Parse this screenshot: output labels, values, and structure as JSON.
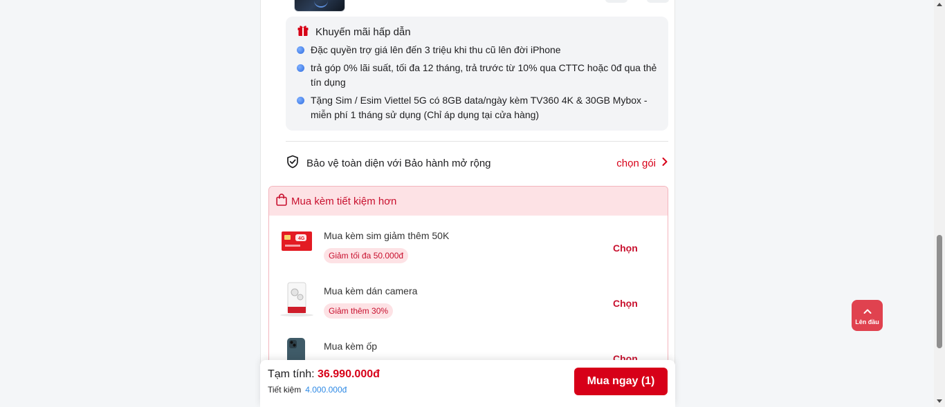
{
  "promotions": {
    "title": "Khuyến mãi hấp dẫn",
    "items": [
      "Đặc quyền trợ giá lên đến 3 triệu khi thu cũ lên đời iPhone",
      "trả góp 0% lãi suất, tối đa 12 tháng, trả trước từ 10% qua CTTC hoặc 0đ qua thẻ tín dụng",
      "Tặng Sim / Esim Viettel 5G có 8GB data/ngày kèm TV360 4K & 30GB Mybox - miễn phí 1 tháng sử dụng (Chỉ áp dụng tại cửa hàng)"
    ]
  },
  "warranty": {
    "label": "Bảo vệ toàn diện với Bảo hành mở rộng",
    "action": "chọn gói"
  },
  "bundle": {
    "title": "Mua kèm tiết kiệm hơn",
    "items": [
      {
        "title": "Mua kèm sim giảm thêm 50K",
        "badge": "Giảm tối đa 50.000đ",
        "action": "Chọn"
      },
      {
        "title": "Mua kèm dán camera",
        "badge": "Giảm thêm 30%",
        "action": "Chọn"
      },
      {
        "title": "Mua kèm ốp",
        "badge": "",
        "action": "Chọn"
      }
    ]
  },
  "footer": {
    "total_label": "Tạm tính:",
    "total_value": "36.990.000đ",
    "saving_label": "Tiết kiệm",
    "saving_value": "4.000.000đ",
    "buy_label": "Mua ngay (1)"
  },
  "back_to_top": {
    "label": "Lên đầu"
  },
  "colors": {
    "accent": "#d70018",
    "saving": "#2f8ae5",
    "bundle_bg": "#fde2e5",
    "back_to_top": "#e0424f"
  },
  "icons": [
    "gift-icon",
    "shield-check-icon",
    "chevron-right-icon",
    "shopping-bag-icon",
    "arrow-up-icon"
  ]
}
